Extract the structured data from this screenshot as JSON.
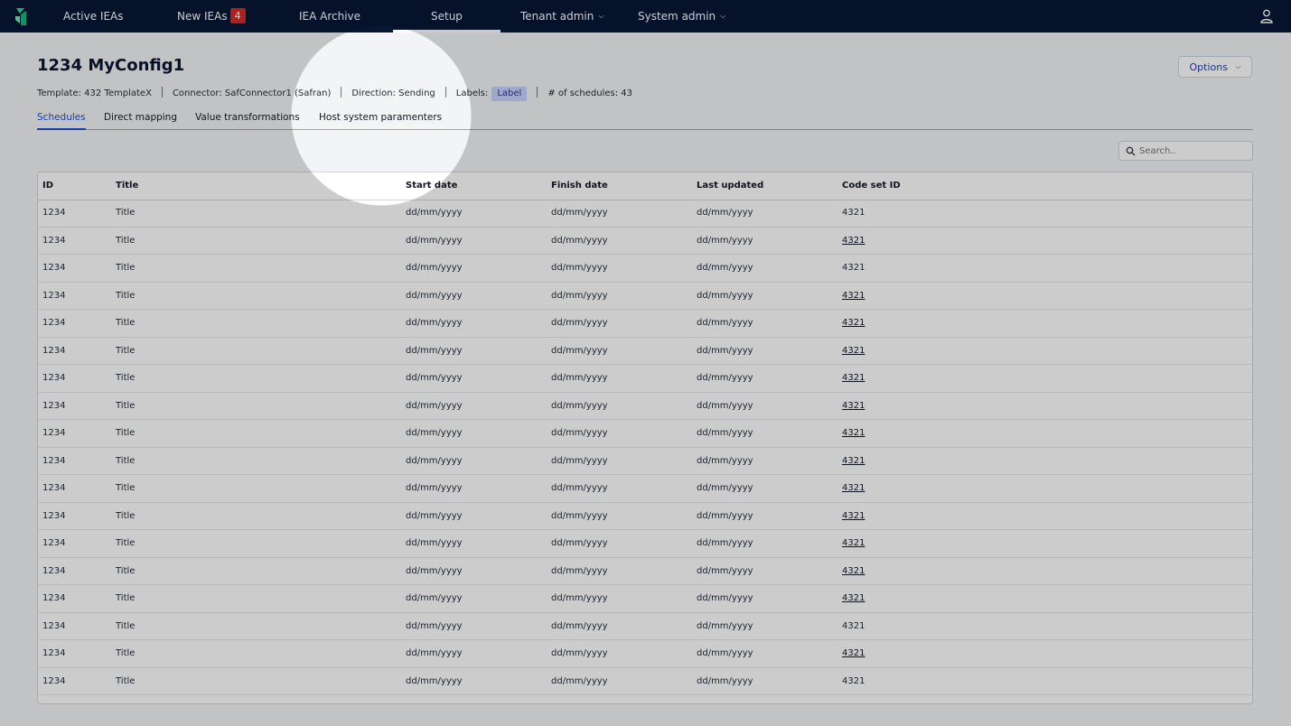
{
  "nav": {
    "items": [
      {
        "label": "Active IEAs"
      },
      {
        "label": "New IEAs",
        "badge": "4"
      },
      {
        "label": "IEA Archive"
      },
      {
        "label": "Setup"
      },
      {
        "label": "Tenant admin"
      },
      {
        "label": "System admin"
      }
    ],
    "active": "Setup"
  },
  "page": {
    "title": "1234 MyConfig1",
    "options_label": "Options",
    "meta": {
      "template": "Template: 432 TemplateX",
      "connector": "Connector: SafConnector1  (Safran)",
      "direction": "Direction: Sending",
      "labels_prefix": "Labels:",
      "label_chip": "Label",
      "schedules": "# of schedules: 43"
    }
  },
  "tabs": [
    {
      "label": "Schedules",
      "active": true
    },
    {
      "label": "Direct mapping"
    },
    {
      "label": "Value transformations"
    },
    {
      "label": "Host system paramenters"
    }
  ],
  "search": {
    "placeholder": "Search.."
  },
  "table": {
    "headers": [
      "ID",
      "Title",
      "Start date",
      "Finish date",
      "Last updated",
      "Code set ID"
    ],
    "rows": [
      {
        "id": "1234",
        "title": "Title",
        "start": "dd/mm/yyyy",
        "finish": "dd/mm/yyyy",
        "updated": "dd/mm/yyyy",
        "code": "4321",
        "code_link": false
      },
      {
        "id": "1234",
        "title": "Title",
        "start": "dd/mm/yyyy",
        "finish": "dd/mm/yyyy",
        "updated": "dd/mm/yyyy",
        "code": "4321",
        "code_link": true
      },
      {
        "id": "1234",
        "title": "Title",
        "start": "dd/mm/yyyy",
        "finish": "dd/mm/yyyy",
        "updated": "dd/mm/yyyy",
        "code": "4321",
        "code_link": false
      },
      {
        "id": "1234",
        "title": "Title",
        "start": "dd/mm/yyyy",
        "finish": "dd/mm/yyyy",
        "updated": "dd/mm/yyyy",
        "code": "4321",
        "code_link": true
      },
      {
        "id": "1234",
        "title": "Title",
        "start": "dd/mm/yyyy",
        "finish": "dd/mm/yyyy",
        "updated": "dd/mm/yyyy",
        "code": "4321",
        "code_link": true
      },
      {
        "id": "1234",
        "title": "Title",
        "start": "dd/mm/yyyy",
        "finish": "dd/mm/yyyy",
        "updated": "dd/mm/yyyy",
        "code": "4321",
        "code_link": true
      },
      {
        "id": "1234",
        "title": "Title",
        "start": "dd/mm/yyyy",
        "finish": "dd/mm/yyyy",
        "updated": "dd/mm/yyyy",
        "code": "4321",
        "code_link": true
      },
      {
        "id": "1234",
        "title": "Title",
        "start": "dd/mm/yyyy",
        "finish": "dd/mm/yyyy",
        "updated": "dd/mm/yyyy",
        "code": "4321",
        "code_link": true
      },
      {
        "id": "1234",
        "title": "Title",
        "start": "dd/mm/yyyy",
        "finish": "dd/mm/yyyy",
        "updated": "dd/mm/yyyy",
        "code": "4321",
        "code_link": true
      },
      {
        "id": "1234",
        "title": "Title",
        "start": "dd/mm/yyyy",
        "finish": "dd/mm/yyyy",
        "updated": "dd/mm/yyyy",
        "code": "4321",
        "code_link": true
      },
      {
        "id": "1234",
        "title": "Title",
        "start": "dd/mm/yyyy",
        "finish": "dd/mm/yyyy",
        "updated": "dd/mm/yyyy",
        "code": "4321",
        "code_link": true
      },
      {
        "id": "1234",
        "title": "Title",
        "start": "dd/mm/yyyy",
        "finish": "dd/mm/yyyy",
        "updated": "dd/mm/yyyy",
        "code": "4321",
        "code_link": true
      },
      {
        "id": "1234",
        "title": "Title",
        "start": "dd/mm/yyyy",
        "finish": "dd/mm/yyyy",
        "updated": "dd/mm/yyyy",
        "code": "4321",
        "code_link": true
      },
      {
        "id": "1234",
        "title": "Title",
        "start": "dd/mm/yyyy",
        "finish": "dd/mm/yyyy",
        "updated": "dd/mm/yyyy",
        "code": "4321",
        "code_link": true
      },
      {
        "id": "1234",
        "title": "Title",
        "start": "dd/mm/yyyy",
        "finish": "dd/mm/yyyy",
        "updated": "dd/mm/yyyy",
        "code": "4321",
        "code_link": true
      },
      {
        "id": "1234",
        "title": "Title",
        "start": "dd/mm/yyyy",
        "finish": "dd/mm/yyyy",
        "updated": "dd/mm/yyyy",
        "code": "4321",
        "code_link": false
      },
      {
        "id": "1234",
        "title": "Title",
        "start": "dd/mm/yyyy",
        "finish": "dd/mm/yyyy",
        "updated": "dd/mm/yyyy",
        "code": "4321",
        "code_link": true
      },
      {
        "id": "1234",
        "title": "Title",
        "start": "dd/mm/yyyy",
        "finish": "dd/mm/yyyy",
        "updated": "dd/mm/yyyy",
        "code": "4321",
        "code_link": false
      }
    ]
  }
}
